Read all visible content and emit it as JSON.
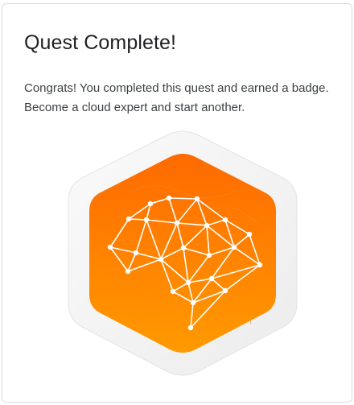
{
  "card": {
    "title": "Quest Complete!",
    "message": "Congrats! You completed this quest and earned a badge. Become a cloud expert and start another."
  },
  "badge": {
    "icon": "brain-network-icon",
    "colors": {
      "outer_frame": "#f1f1f1",
      "orange_top": "#ff6d00",
      "orange_bottom": "#ff9500",
      "network_lines": "#ffffff"
    }
  }
}
